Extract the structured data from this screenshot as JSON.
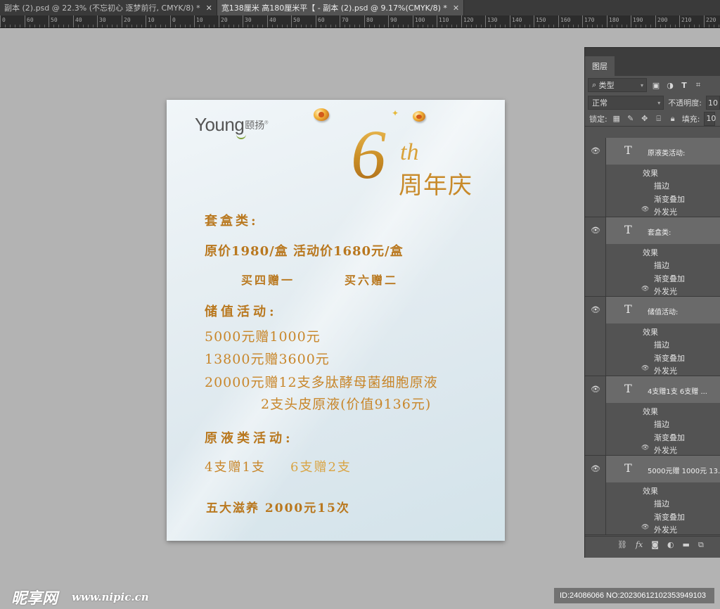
{
  "tabs": [
    {
      "label": "副本 (2).psd @ 22.3% (不忘初心 逐梦前行, CMYK/8) *",
      "close": "✕",
      "active": false
    },
    {
      "label": "宽138厘米  高180厘米平【 - 副本 (2).psd @ 9.17%(CMYK/8) *",
      "close": "✕",
      "active": true
    }
  ],
  "ruler": {
    "labels": [
      "0",
      "60",
      "50",
      "40",
      "30",
      "20",
      "10",
      "0",
      "10",
      "20",
      "30",
      "40",
      "50",
      "60",
      "70",
      "80",
      "90",
      "100",
      "110",
      "120",
      "130",
      "140",
      "150",
      "160",
      "170",
      "180",
      "190",
      "200",
      "210",
      "220"
    ]
  },
  "canvas": {
    "logo": {
      "brand": "Young",
      "cn": "颐扬",
      "reg": "®"
    },
    "anniv": {
      "num": "6",
      "sup": "th",
      "cn": "周年庆"
    },
    "lines": [
      "套盒类:",
      "原价1980/盒   活动价1680元/盒",
      "买四赠一",
      "买六赠二",
      "储值活动:",
      "5000元赠1000元",
      "13800元赠3600元",
      "20000元赠12支多肽酵母菌细胞原液",
      "2支头皮原液(价值9136元)",
      "原液类活动:",
      "4支赠1支",
      "6支赠2支",
      "五大滋养 2000元15次"
    ]
  },
  "layers_panel": {
    "tab": "图层",
    "filter_label": "类型",
    "blend_mode": "正常",
    "opacity_label": "不透明度:",
    "opacity_value": "10",
    "lock_label": "锁定:",
    "fill_label": "填充:",
    "fill_value": "10",
    "layers": [
      {
        "name": "原液类活动:",
        "effects_label": "效果",
        "effects": [
          "描边",
          "渐变叠加",
          "外发光"
        ]
      },
      {
        "name": "套盒类:",
        "effects_label": "效果",
        "effects": [
          "描边",
          "渐变叠加",
          "外发光"
        ]
      },
      {
        "name": "储值活动:",
        "effects_label": "效果",
        "effects": [
          "描边",
          "渐变叠加",
          "外发光"
        ]
      },
      {
        "name": "4支赠1支    6支赠 ...",
        "effects_label": "效果",
        "effects": [
          "描边",
          "渐变叠加",
          "外发光"
        ]
      },
      {
        "name": "5000元赠 1000元  13...",
        "effects_label": "效果",
        "effects": [
          "描边",
          "渐变叠加",
          "外发光"
        ]
      }
    ],
    "footer_fx": "fx"
  },
  "watermark": {
    "logo": "昵享网",
    "url": "www.nipic.cn",
    "id": "ID:24086066 NO:20230612102353949103"
  }
}
